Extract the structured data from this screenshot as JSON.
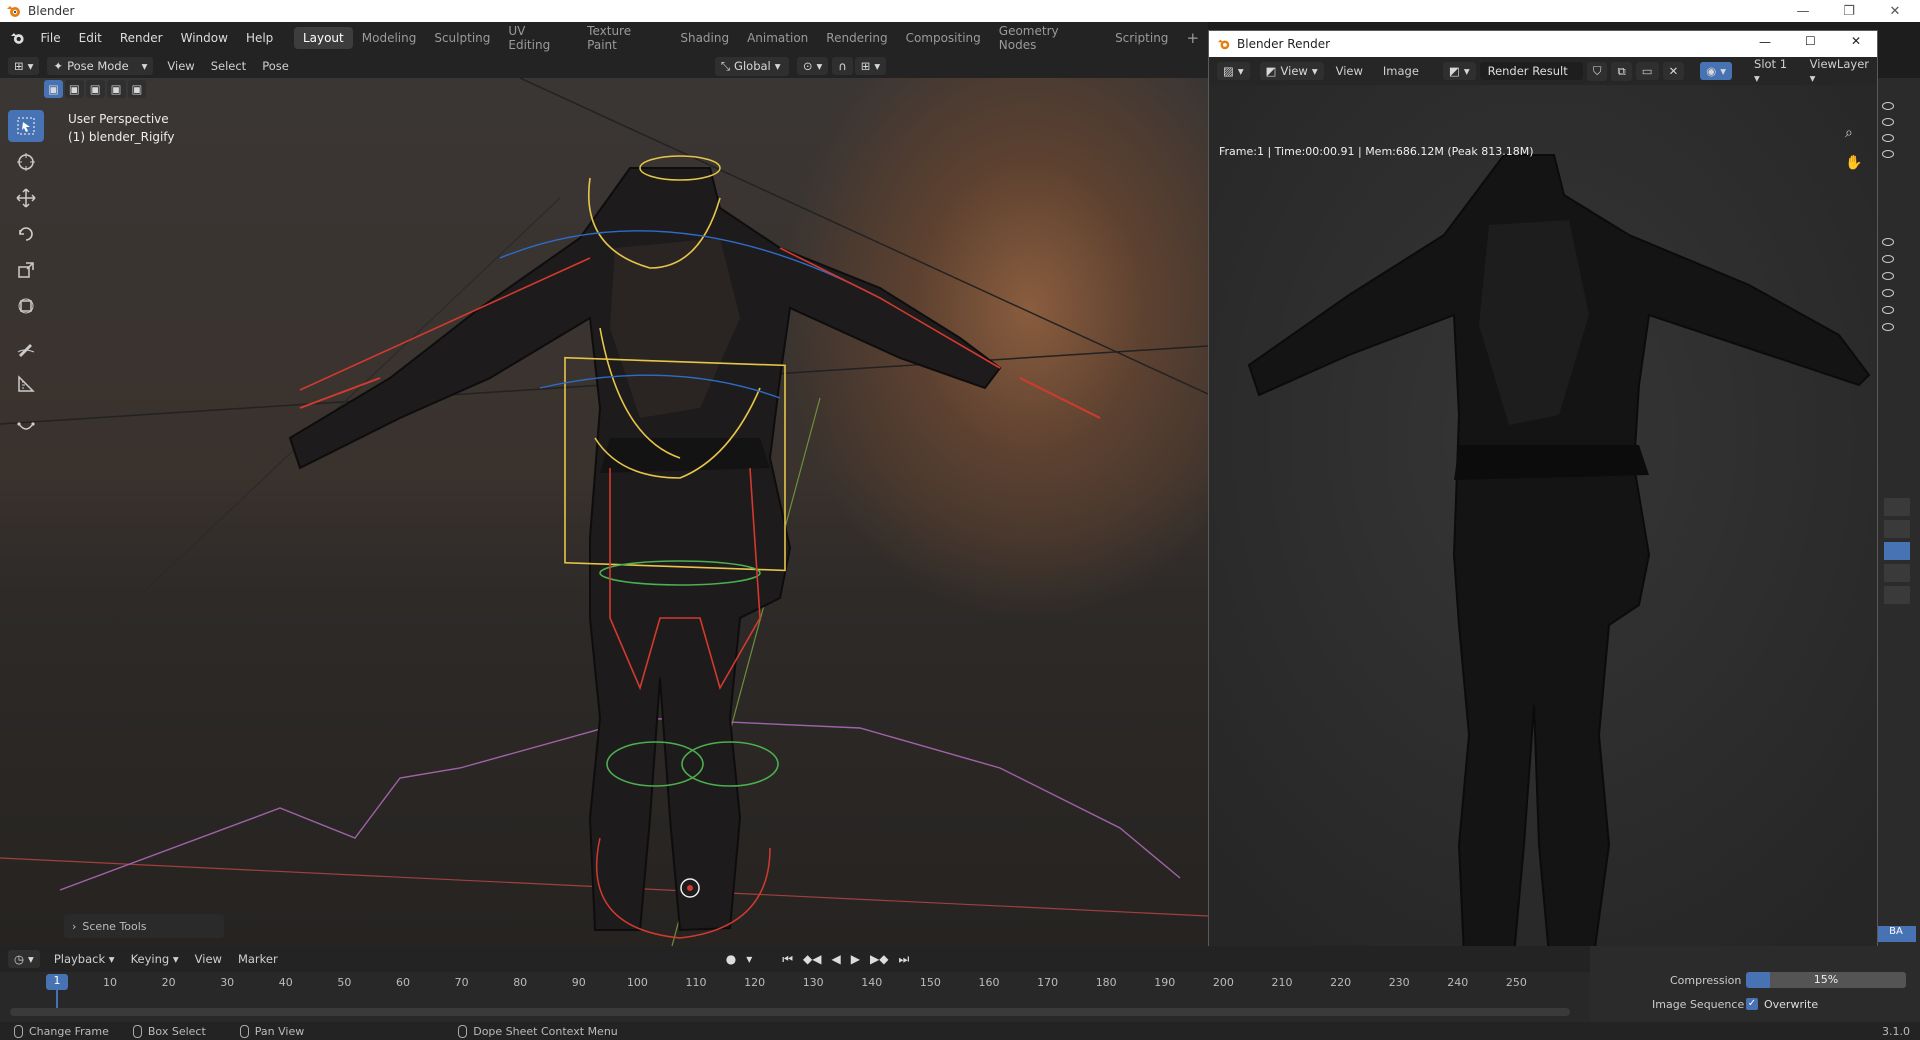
{
  "window": {
    "title": "Blender"
  },
  "menu": [
    "File",
    "Edit",
    "Render",
    "Window",
    "Help"
  ],
  "workspaces": [
    {
      "label": "Layout",
      "active": true
    },
    {
      "label": "Modeling"
    },
    {
      "label": "Sculpting"
    },
    {
      "label": "UV Editing"
    },
    {
      "label": "Texture Paint"
    },
    {
      "label": "Shading"
    },
    {
      "label": "Animation"
    },
    {
      "label": "Rendering"
    },
    {
      "label": "Compositing"
    },
    {
      "label": "Geometry Nodes"
    },
    {
      "label": "Scripting"
    }
  ],
  "viewport": {
    "mode": "Pose Mode",
    "menus": [
      "View",
      "Select",
      "Pose"
    ],
    "orientation": "Global",
    "overlay_text_1": "User Perspective",
    "overlay_text_2": "(1) blender_Rigify",
    "scene_tools": "Scene Tools"
  },
  "render_window": {
    "title": "Blender Render",
    "menus": [
      "View",
      "Image"
    ],
    "result": "Render Result",
    "slot": "Slot 1",
    "layer": "ViewLayer",
    "info": "Frame:1 | Time:00:00.91 | Mem:686.12M (Peak 813.18M)"
  },
  "timeline": {
    "menus": [
      "Playback",
      "Keying",
      "View",
      "Marker"
    ],
    "current_frame": "1",
    "ticks": [
      "10",
      "20",
      "30",
      "40",
      "50",
      "60",
      "70",
      "80",
      "90",
      "100",
      "110",
      "120",
      "130",
      "140",
      "150",
      "160",
      "170",
      "180",
      "190",
      "200",
      "210",
      "220",
      "230",
      "240",
      "250"
    ]
  },
  "properties": {
    "badge": "BA",
    "compression_label": "Compression",
    "compression_value": "15%",
    "compression_fraction": 0.15,
    "image_sequence_label": "Image Sequence",
    "overwrite_label": "Overwrite",
    "overwrite_checked": true
  },
  "statusbar": {
    "items": [
      "Change Frame",
      "Box Select",
      "Pan View",
      "Dope Sheet Context Menu"
    ],
    "version": "3.1.0"
  },
  "colors": {
    "accent": "#4772b3",
    "header": "#232323",
    "bone_yellow": "#e6c54a",
    "bone_red": "#d23a2f",
    "bone_green": "#4caf50"
  }
}
